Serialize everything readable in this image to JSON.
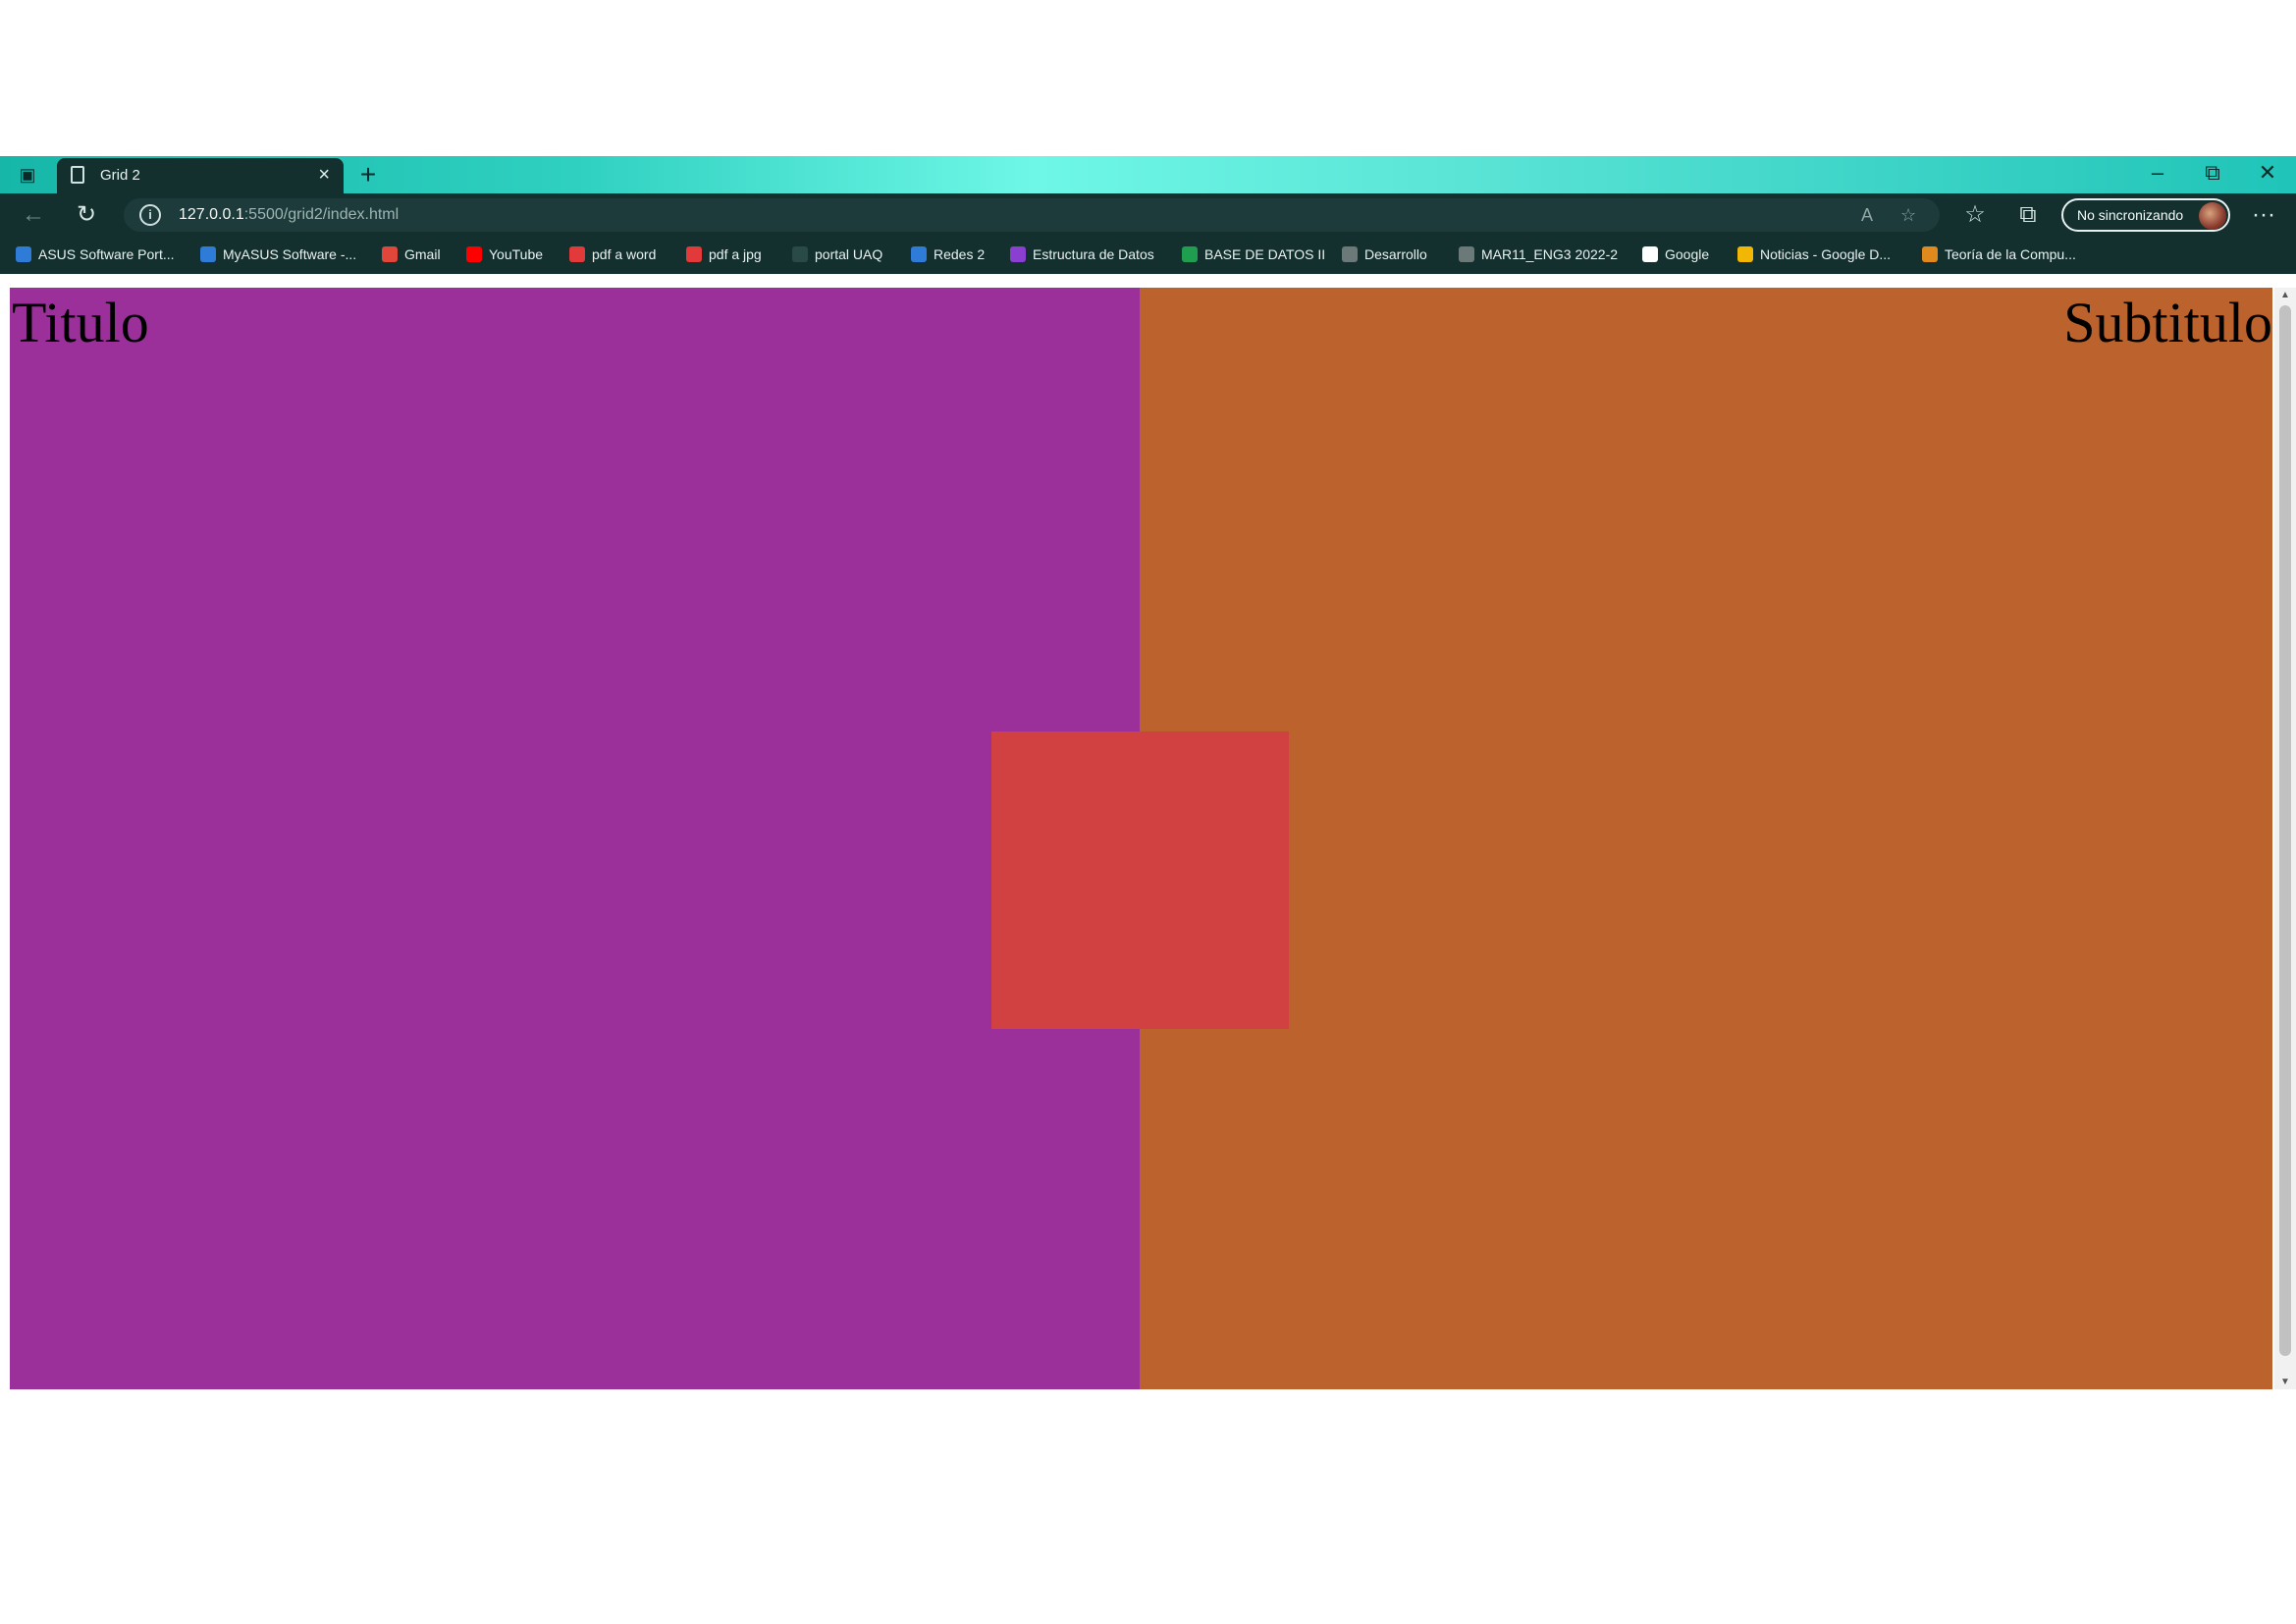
{
  "tab": {
    "title": "Grid 2",
    "close": "×"
  },
  "new_tab": "+",
  "window_controls": {
    "minimize": "–",
    "restore": "⧉",
    "close": "✕"
  },
  "address_bar": {
    "host": "127.0.0.1",
    "path": ":5500/grid2/index.html"
  },
  "profile": {
    "label": "No sincronizando"
  },
  "more_menu": "···",
  "bookmarks": [
    {
      "label": "ASUS Software Port...",
      "icon": "asus-icon",
      "color": "#2f7bd8"
    },
    {
      "label": "MyASUS Software -...",
      "icon": "asus-icon",
      "color": "#2f7bd8"
    },
    {
      "label": "Gmail",
      "icon": "gmail-icon",
      "color": "#e0463a"
    },
    {
      "label": "YouTube",
      "icon": "youtube-icon",
      "color": "#ff0000"
    },
    {
      "label": "pdf a word",
      "icon": "heart-icon",
      "color": "#e23a3a"
    },
    {
      "label": "pdf a jpg",
      "icon": "heart-icon",
      "color": "#e23a3a"
    },
    {
      "label": "portal UAQ",
      "icon": "cart-icon",
      "color": "#2a4a48"
    },
    {
      "label": "Redes 2",
      "icon": "classroom-icon",
      "color": "#2f7bd8"
    },
    {
      "label": "Estructura de Datos",
      "icon": "classroom-icon",
      "color": "#8a3fd1"
    },
    {
      "label": "BASE DE DATOS II",
      "icon": "classroom-icon",
      "color": "#1e9e4e"
    },
    {
      "label": "Desarrollo",
      "icon": "classroom-icon",
      "color": "#6b7a79"
    },
    {
      "label": "MAR11_ENG3 2022-2",
      "icon": "classroom-icon",
      "color": "#6b7a79"
    },
    {
      "label": "Google",
      "icon": "google-icon",
      "color": "#ffffff"
    },
    {
      "label": "Noticias - Google D...",
      "icon": "drive-icon",
      "color": "#f2b705"
    },
    {
      "label": "Teoría de la Compu...",
      "icon": "classroom-icon",
      "color": "#e08a1e"
    }
  ],
  "page": {
    "title": "Titulo",
    "subtitle": "Subtitulo",
    "colors": {
      "left": "#9b309b",
      "right": "#bb622d",
      "center": "#d14141"
    }
  }
}
